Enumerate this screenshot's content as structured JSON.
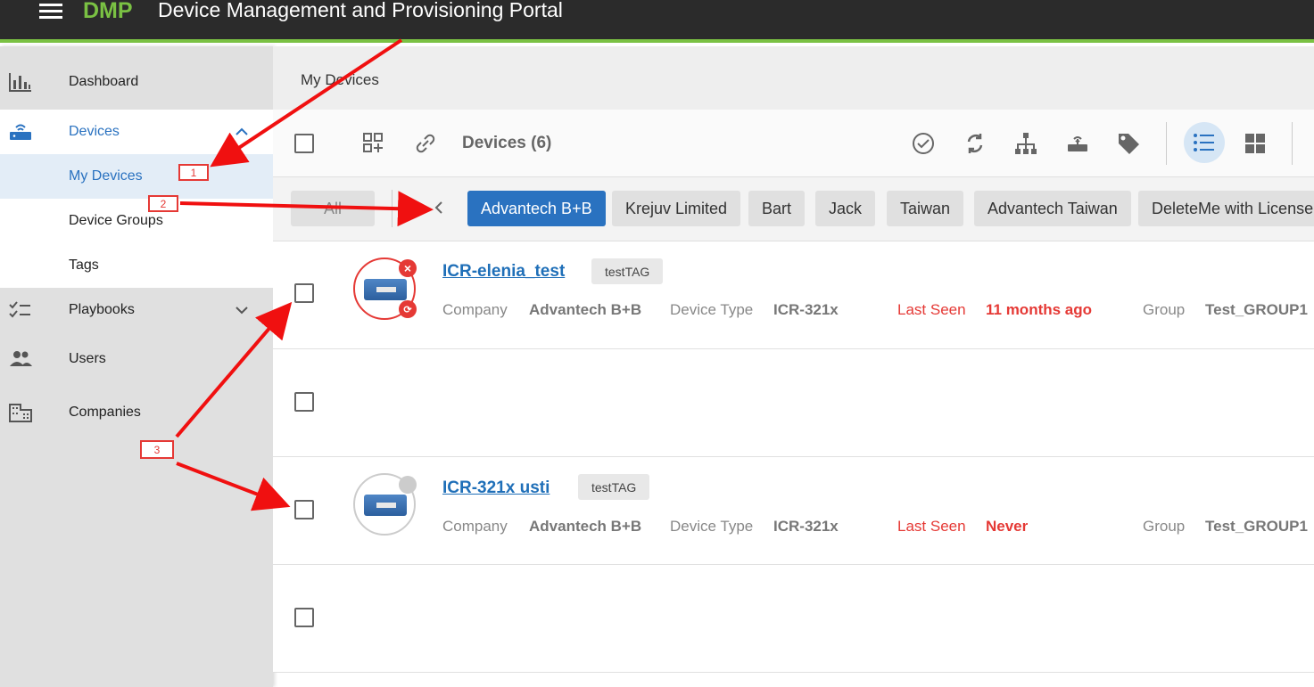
{
  "header": {
    "brand": "DMP",
    "title": "Device Management and Provisioning Portal"
  },
  "sidebar": {
    "items": [
      {
        "label": "Dashboard",
        "icon": "bar-chart-icon"
      },
      {
        "label": "Devices",
        "icon": "router-icon"
      },
      {
        "label": "My Devices"
      },
      {
        "label": "Device Groups"
      },
      {
        "label": "Tags"
      },
      {
        "label": "Playbooks",
        "icon": "checklist-icon"
      },
      {
        "label": "Users",
        "icon": "users-icon"
      },
      {
        "label": "Companies",
        "icon": "building-icon"
      }
    ]
  },
  "breadcrumb": "My Devices",
  "toolbar": {
    "devices_count": "Devices (6)"
  },
  "filters": [
    "All",
    "Advantech B+B",
    "Krejuv Limited",
    "Bart",
    "Jack",
    "Taiwan",
    "Advantech Taiwan",
    "DeleteMe with License"
  ],
  "labels": {
    "company": "Company",
    "device_type": "Device Type",
    "last_seen": "Last Seen",
    "group": "Group"
  },
  "devices": [
    {
      "name": "ICR-elenia_test",
      "tag": "testTAG",
      "company": "Advantech B+B",
      "device_type": "ICR-321x",
      "last_seen": "11 months ago",
      "group": "Test_GROUP1"
    },
    {
      "name": "ICR-321x usti",
      "tag": "testTAG",
      "company": "Advantech B+B",
      "device_type": "ICR-321x",
      "last_seen": "Never",
      "group": "Test_GROUP1"
    }
  ],
  "annotations": [
    "1",
    "2",
    "3"
  ],
  "colors": {
    "accent": "#7ac143",
    "primary": "#2a72c0",
    "alert": "#e53935"
  }
}
